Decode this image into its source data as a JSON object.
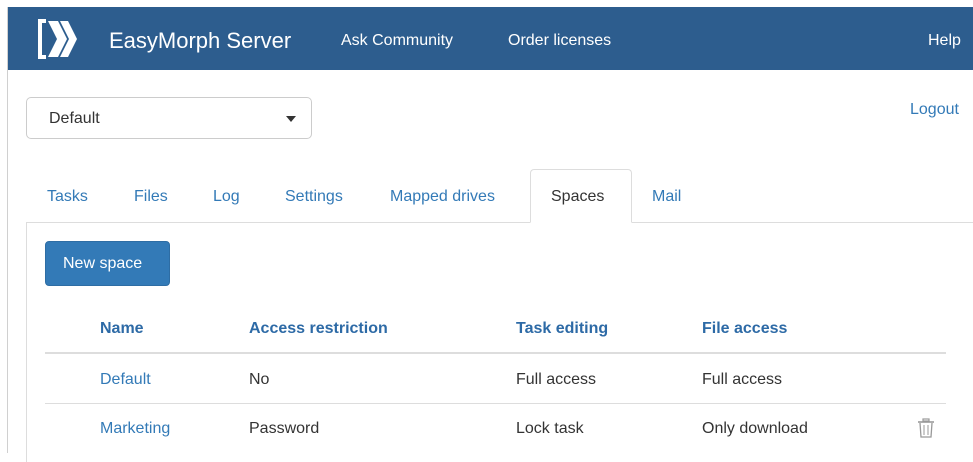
{
  "header": {
    "brand": "EasyMorph Server",
    "links": [
      "Ask Community",
      "Order licenses"
    ],
    "help": "Help",
    "logo_icon": "easymorph-logo-icon",
    "background": "#2d5d8e"
  },
  "space_selector": {
    "value": "Default",
    "icon": "chevron-down-icon"
  },
  "logout": "Logout",
  "tabs": {
    "items": [
      "Tasks",
      "Files",
      "Log",
      "Settings",
      "Mapped drives",
      "Spaces",
      "Mail"
    ],
    "active": "Spaces"
  },
  "actions": {
    "new_space": "New space"
  },
  "table": {
    "columns": [
      "Name",
      "Access restriction",
      "Task editing",
      "File access"
    ],
    "rows": [
      {
        "name": "Default",
        "access_restriction": "No",
        "task_editing": "Full access",
        "file_access": "Full access"
      },
      {
        "name": "Marketing",
        "access_restriction": "Password",
        "task_editing": "Lock task",
        "file_access": "Only download",
        "delete_icon": "trash-icon"
      }
    ]
  },
  "colors": {
    "accent": "#337ab7",
    "header_text": "#2d6aa6"
  }
}
